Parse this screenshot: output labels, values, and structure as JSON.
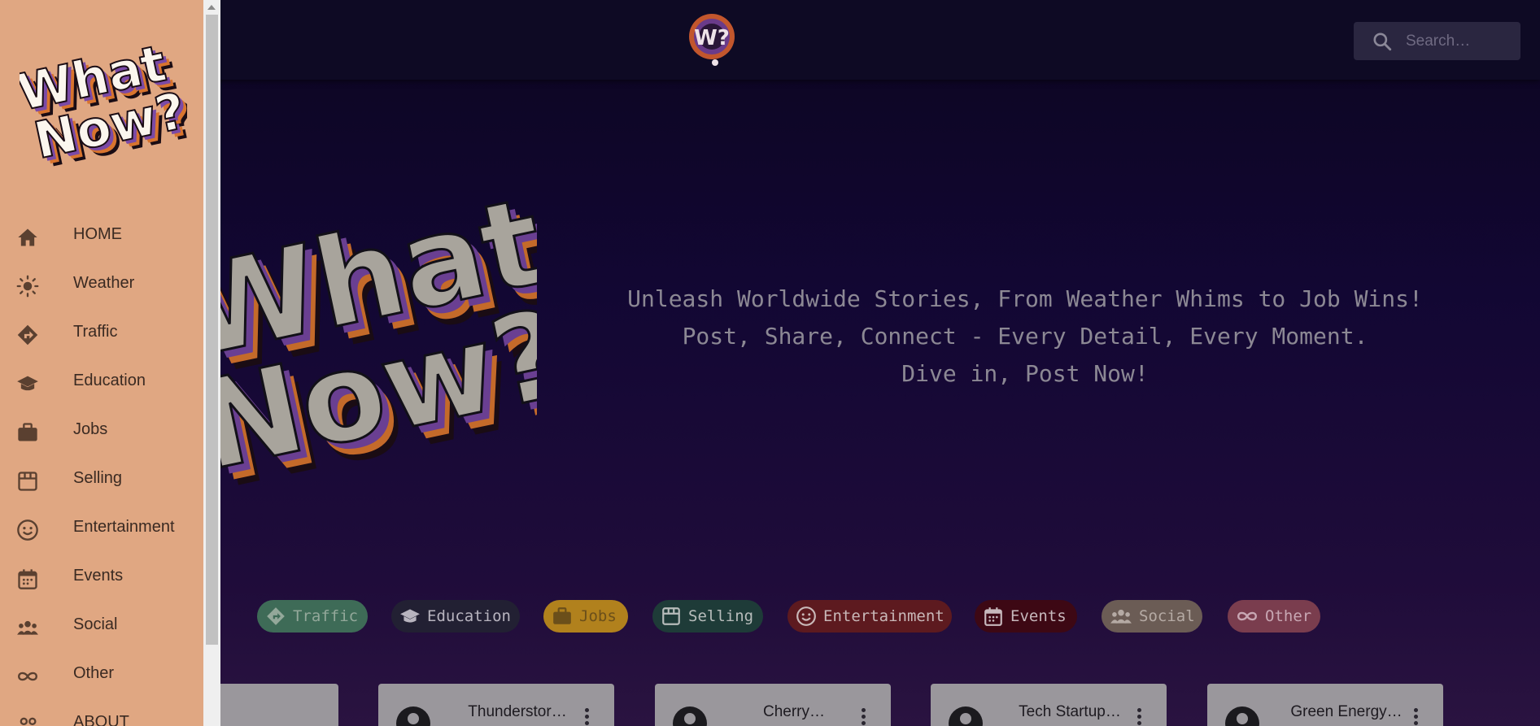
{
  "header": {
    "logo_text": "W?",
    "search_placeholder": "Search…"
  },
  "hero": {
    "logo_line1": "What",
    "logo_line2": "Now?",
    "tagline": [
      "Unleash Worldwide Stories, From Weather Whims to Job Wins!",
      "Post, Share, Connect - Every Detail, Every Moment.",
      "Dive in, Post Now!"
    ]
  },
  "categories": [
    {
      "label": "Traffic",
      "icon": "directions-icon",
      "color": "#3e6b57",
      "text_color": "#93a89a"
    },
    {
      "label": "Education",
      "icon": "school-icon",
      "color": "#222033",
      "text_color": "#b8b4bf"
    },
    {
      "label": "Jobs",
      "icon": "briefcase-icon",
      "color": "#b1811d",
      "text_color": "#6b4f1a"
    },
    {
      "label": "Selling",
      "icon": "store-icon",
      "color": "#1e3b38",
      "text_color": "#b7bcbb"
    },
    {
      "label": "Entertainment",
      "icon": "smiley-icon",
      "color": "#5d1a1f",
      "text_color": "#c9b8b8"
    },
    {
      "label": "Events",
      "icon": "calendar-icon",
      "color": "#3d0814",
      "text_color": "#c7b8bc"
    },
    {
      "label": "Social",
      "icon": "people-icon",
      "color": "#6b5c55",
      "text_color": "#b5aaa4"
    },
    {
      "label": "Other",
      "icon": "infinity-icon",
      "color": "#7a3d4e",
      "text_color": "#c8a7b3"
    }
  ],
  "cards": [
    {
      "title": ""
    },
    {
      "title": "Thunderstor…"
    },
    {
      "title": "Cherry…"
    },
    {
      "title": "Tech Startup…"
    },
    {
      "title": "Green Energy…"
    }
  ],
  "drawer": {
    "logo_line1": "What",
    "logo_line2": "Now?",
    "items": [
      {
        "label": "HOME",
        "icon": "home-icon"
      },
      {
        "label": "Weather",
        "icon": "sun-icon"
      },
      {
        "label": "Traffic",
        "icon": "directions-icon"
      },
      {
        "label": "Education",
        "icon": "school-icon"
      },
      {
        "label": "Jobs",
        "icon": "briefcase-icon"
      },
      {
        "label": "Selling",
        "icon": "store-icon"
      },
      {
        "label": "Entertainment",
        "icon": "smiley-icon"
      },
      {
        "label": "Events",
        "icon": "calendar-icon"
      },
      {
        "label": "Social",
        "icon": "people-icon"
      },
      {
        "label": "Other",
        "icon": "infinity-icon"
      },
      {
        "label": "ABOUT",
        "icon": "people-outline-icon"
      }
    ]
  },
  "colors": {
    "drawer_bg": "#e0a782",
    "page_bg": "#120733",
    "topbar_bg": "#0e0a24"
  }
}
